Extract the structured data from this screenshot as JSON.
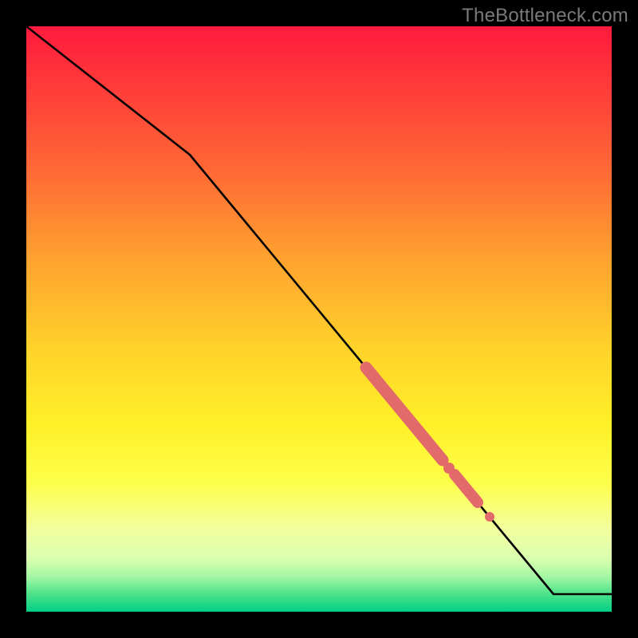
{
  "watermark": "TheBottleneck.com",
  "colors": {
    "line": "#000000",
    "marker_fill": "#e36a6a",
    "marker_stroke": "#b14d4d"
  },
  "chart_data": {
    "type": "line",
    "title": "",
    "xlabel": "",
    "ylabel": "",
    "xlim": [
      0,
      100
    ],
    "ylim": [
      0,
      100
    ],
    "background": "gradient-red-yellow-green-vertical",
    "series": [
      {
        "name": "curve",
        "x": [
          0,
          28,
          90,
          100
        ],
        "y": [
          100,
          78,
          3,
          3
        ]
      }
    ],
    "highlight_segments": [
      {
        "x_start": 58,
        "x_end": 71,
        "thick": true
      },
      {
        "x_start": 73,
        "x_end": 77,
        "thick": true
      }
    ],
    "highlight_points": [
      {
        "x": 72
      },
      {
        "x": 79
      }
    ]
  }
}
